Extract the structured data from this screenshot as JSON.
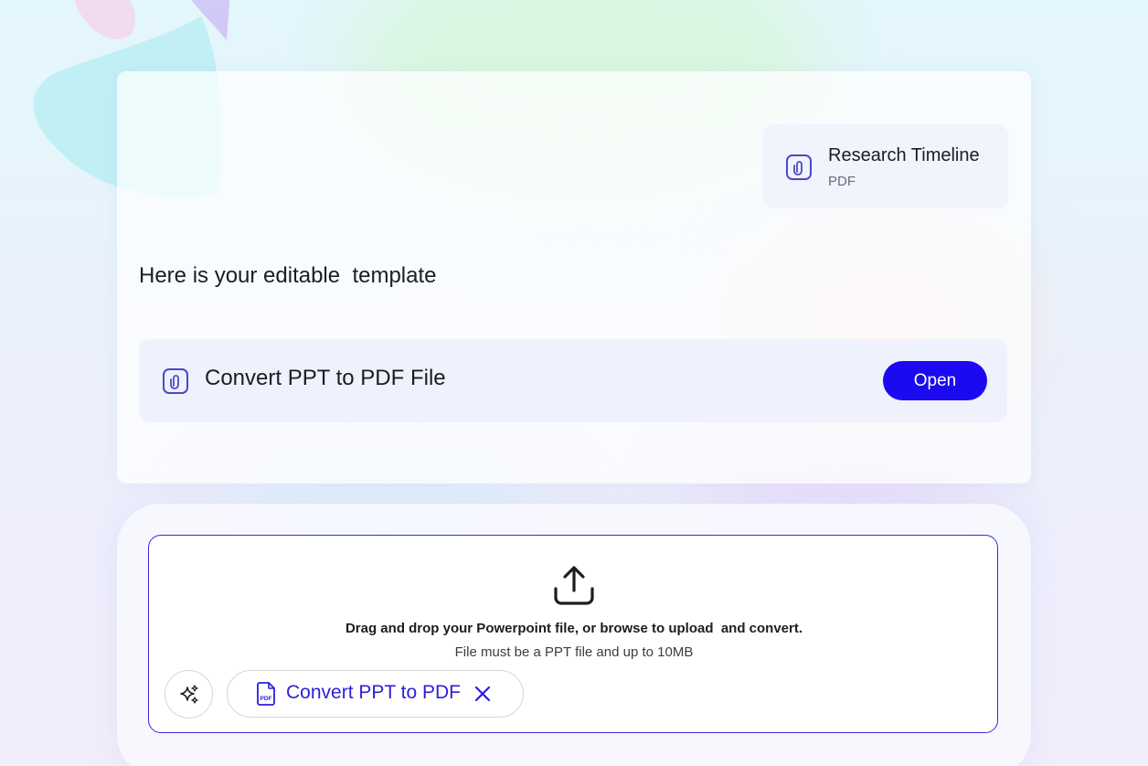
{
  "colors": {
    "accent": "#1b0af0",
    "accent_text": "#2d1ed8",
    "dropzone_border": "#3a2bd6",
    "text_primary": "#1c1d22",
    "text_secondary": "#6a6f7b"
  },
  "attachment": {
    "icon": "paperclip-icon",
    "title": "Research Timeline",
    "type": "PDF"
  },
  "message": {
    "text": "Here is your editable  template"
  },
  "file_card": {
    "icon": "paperclip-icon",
    "title": "Convert PPT to PDF File",
    "open_label": "Open"
  },
  "composer": {
    "upload_icon": "upload-icon",
    "drop_title": "Drag and drop your Powerpoint file, or browse to upload  and convert.",
    "drop_subtitle": "File must be a PPT file and up to 10MB",
    "sparkle_icon": "sparkle-icon",
    "chip": {
      "icon": "pdf-file-icon",
      "label": "Convert PPT to PDF",
      "close_icon": "close-icon"
    }
  }
}
